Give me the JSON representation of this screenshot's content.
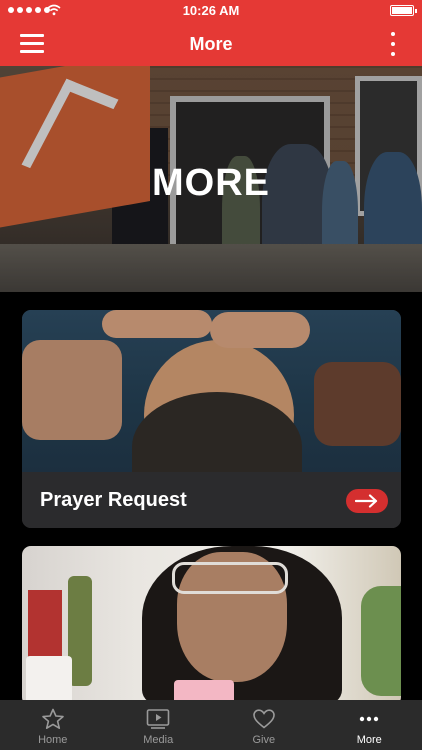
{
  "status_bar": {
    "time": "10:26 AM"
  },
  "app_bar": {
    "title": "More"
  },
  "hero": {
    "title": "MORE"
  },
  "cards": [
    {
      "label": "Prayer Request"
    },
    {
      "label": ""
    }
  ],
  "tabs": [
    {
      "label": "Home",
      "icon": "star-icon",
      "active": false
    },
    {
      "label": "Media",
      "icon": "play-icon",
      "active": false
    },
    {
      "label": "Give",
      "icon": "heart-icon",
      "active": false
    },
    {
      "label": "More",
      "icon": "more-dots-icon",
      "active": true
    }
  ],
  "colors": {
    "brand": "#e53935",
    "card_bg": "#2d2d2f",
    "tabbar_bg": "#2b2b2b",
    "arrow_button": "#d42f2f"
  }
}
